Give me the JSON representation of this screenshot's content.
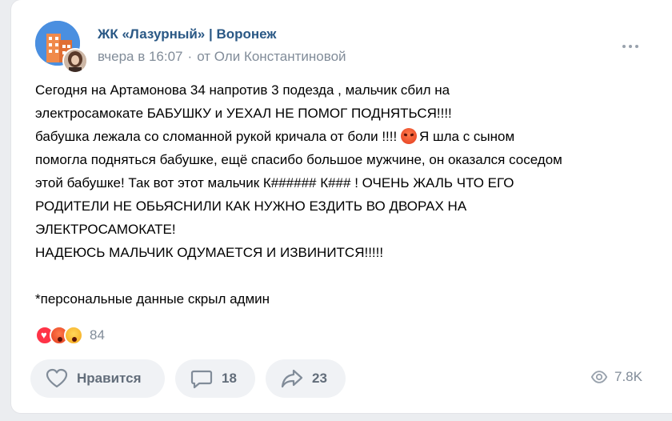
{
  "post": {
    "group_name": "ЖК «Лазурный» | Воронеж",
    "time": "вчера в 16:07",
    "separator": "·",
    "author": "от Оли Константиновой",
    "text_part1": "Сегодня на Артамонова 34 напротив 3 подезда , мальчик сбил на\nэлектросамокате БАБУШКУ и УЕХАЛ НЕ ПОМОГ ПОДНЯТЬСЯ!!!!\nбабушка лежала со сломанной рукой кричала от боли !!!! ",
    "text_part2": "Я шла с сыном\nпомогла подняться бабушке, ещё спасибо большое мужчине, он оказался соседом\nэтой бабушке! Так вот этот мальчик К###### К### ! ОЧЕНЬ ЖАЛЬ ЧТО ЕГО\nРОДИТЕЛИ НЕ ОБЬЯСНИЛИ КАК НУЖНО ЕЗДИТЬ ВО ДВОРАХ НА\nЭЛЕКТРОСАМОКАТЕ!\nНАДЕЮСЬ МАЛЬЧИК ОДУМАЕТСЯ И ИЗВИНИТСЯ!!!!!\n\n*персональные данные скрыл админ"
  },
  "reactions": {
    "icons": [
      "heart-icon",
      "angry-face-icon",
      "surprised-face-icon"
    ],
    "count": "84"
  },
  "actions": {
    "like_label": "Нравится",
    "comments_count": "18",
    "shares_count": "23",
    "views_count": "7.8K"
  },
  "colors": {
    "link": "#2a5885",
    "secondary": "#818c99",
    "button_bg": "#f0f2f5",
    "heart": "#ff3347"
  }
}
